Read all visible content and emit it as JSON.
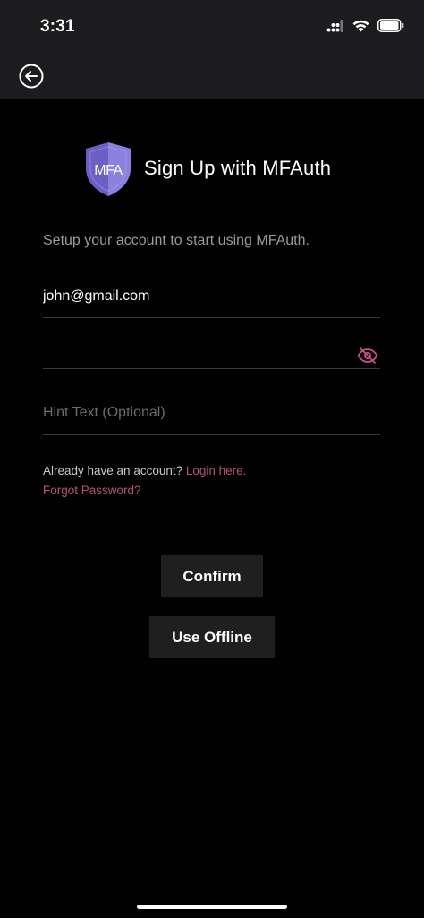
{
  "status_bar": {
    "time": "3:31",
    "icons": [
      "cellular-signal-icon",
      "wifi-icon",
      "battery-icon"
    ]
  },
  "nav": {
    "back_icon": "back-arrow-circle-icon"
  },
  "header": {
    "logo_text": "MFA",
    "title": "Sign Up with MFAuth"
  },
  "subtitle": "Setup your account to start using MFAuth.",
  "form": {
    "email_value": "john@gmail.com",
    "password_value": "",
    "password_toggle_icon": "eye-slash-icon",
    "hint_placeholder": "Hint Text (Optional)"
  },
  "links": {
    "account_prompt": "Already have an account?",
    "login_label": "Login here.",
    "forgot_label": "Forgot Password?"
  },
  "buttons": {
    "confirm_label": "Confirm",
    "offline_label": "Use Offline"
  },
  "colors": {
    "accent_link": "#b5527c",
    "logo_purple": "#7b6fd0",
    "button_bg": "#1f1f1f",
    "topbar_bg": "#1c1c1e"
  }
}
